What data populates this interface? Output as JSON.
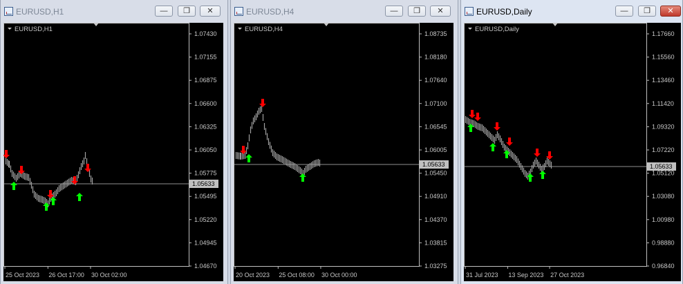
{
  "colors": {
    "up_arrow": "#00ff00",
    "down_arrow": "#ff0000",
    "candles": "#a0a0a0",
    "grid_frame": "#c0c0c0",
    "price_line": "#c0c0c0"
  },
  "windows": [
    {
      "title": "EURUSD,H1",
      "label": "EURUSD,H1",
      "y_ticks": [
        "1.07430",
        "1.07155",
        "1.06875",
        "1.06600",
        "1.06325",
        "1.06050",
        "1.05775",
        "1.05495",
        "1.05220",
        "1.04945",
        "1.04670"
      ],
      "x_ticks": [
        "25 Oct 2023",
        "26 Oct 17:00",
        "30 Oct 02:00"
      ],
      "current_price": "1.05633",
      "minimize": "—",
      "restore": "❐",
      "close": "✕"
    },
    {
      "title": "EURUSD,H4",
      "label": "EURUSD,H4",
      "y_ticks": [
        "1.08735",
        "1.08180",
        "1.07640",
        "1.07100",
        "1.06545",
        "1.06005",
        "1.05450",
        "1.04910",
        "1.04370",
        "1.03815",
        "1.03275"
      ],
      "x_ticks": [
        "20 Oct 2023",
        "25 Oct 08:00",
        "30 Oct 00:00"
      ],
      "current_price": "1.05633",
      "minimize": "—",
      "restore": "❐",
      "close": "✕"
    },
    {
      "title": "EURUSD,Daily",
      "label": "EURUSD,Daily",
      "y_ticks": [
        "1.17660",
        "1.15560",
        "1.13460",
        "1.11420",
        "1.09320",
        "1.07220",
        "1.05120",
        "1.03080",
        "1.00980",
        "0.98880",
        "0.96840"
      ],
      "x_ticks": [
        "31 Jul 2023",
        "13 Sep 2023",
        "27 Oct 2023"
      ],
      "current_price": "1.05633",
      "minimize": "—",
      "restore": "❐",
      "close": "✕"
    }
  ]
}
